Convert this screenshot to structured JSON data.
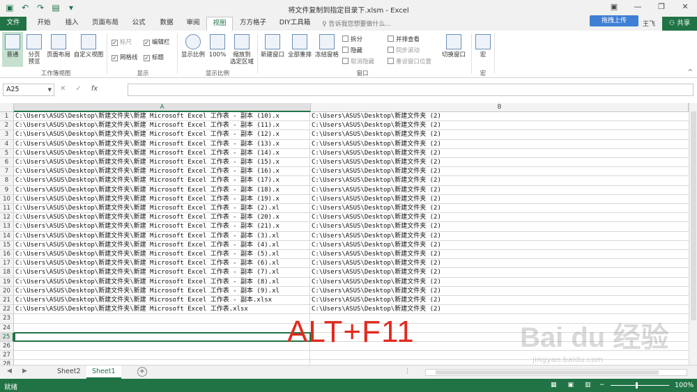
{
  "window": {
    "title": "将文件复制到指定目录下.xlsm - Excel",
    "qat_icons": [
      "save-icon",
      "undo-icon",
      "redo-icon",
      "form-icon",
      "qat-more-icon"
    ],
    "ribbon_display_icon": "▣",
    "minimize_icon": "—",
    "maximize_icon": "❐",
    "close_icon": "✕"
  },
  "tabs": [
    "文件",
    "开始",
    "插入",
    "页面布局",
    "公式",
    "数据",
    "审阅",
    "视图",
    "方方格子",
    "DIY工具箱"
  ],
  "active_tab": "视图",
  "tellme": "告诉我您想要做什么...",
  "account": {
    "upload_label": "拖拽上传",
    "user_name": "王飞",
    "share_label": "共享"
  },
  "ribbon": {
    "workbook_views": {
      "normal": "普通",
      "page_break_1": "分页",
      "page_break_2": "预览",
      "page_layout": "页面布局",
      "custom_views": "自定义视图",
      "group": "工作簿视图"
    },
    "show": {
      "ruler": "标尺",
      "formula_bar": "编辑栏",
      "gridlines": "网格线",
      "headings": "标题",
      "group": "显示"
    },
    "zoom": {
      "zoom": "显示比例",
      "hundred": "100%",
      "zoom_sel_1": "缩放到",
      "zoom_sel_2": "选定区域",
      "group": "显示比例"
    },
    "window": {
      "new_window": "新建窗口",
      "arrange_all": "全部重排",
      "freeze": "冻结窗格",
      "split": "拆分",
      "hide": "隐藏",
      "unhide": "取消隐藏",
      "side_by_side": "并排查看",
      "sync_scroll": "同步滚动",
      "reset_pos": "重设窗口位置",
      "switch": "切换窗口",
      "group": "窗口"
    },
    "macros": {
      "macros": "宏",
      "group": "宏"
    }
  },
  "formula_bar": {
    "name_box": "A25",
    "value": ""
  },
  "columns": [
    "A",
    "B"
  ],
  "rows": [
    {
      "n": "1",
      "a": "C:\\Users\\ASUS\\Desktop\\新建文件夹\\新建 Microsoft Excel 工作表 - 副本 (10).x",
      "b": "C:\\Users\\ASUS\\Desktop\\新建文件夹 (2)"
    },
    {
      "n": "2",
      "a": "C:\\Users\\ASUS\\Desktop\\新建文件夹\\新建 Microsoft Excel 工作表 - 副本 (11).x",
      "b": "C:\\Users\\ASUS\\Desktop\\新建文件夹 (2)"
    },
    {
      "n": "3",
      "a": "C:\\Users\\ASUS\\Desktop\\新建文件夹\\新建 Microsoft Excel 工作表 - 副本 (12).x",
      "b": "C:\\Users\\ASUS\\Desktop\\新建文件夹 (2)"
    },
    {
      "n": "4",
      "a": "C:\\Users\\ASUS\\Desktop\\新建文件夹\\新建 Microsoft Excel 工作表 - 副本 (13).x",
      "b": "C:\\Users\\ASUS\\Desktop\\新建文件夹 (2)"
    },
    {
      "n": "5",
      "a": "C:\\Users\\ASUS\\Desktop\\新建文件夹\\新建 Microsoft Excel 工作表 - 副本 (14).x",
      "b": "C:\\Users\\ASUS\\Desktop\\新建文件夹 (2)"
    },
    {
      "n": "6",
      "a": "C:\\Users\\ASUS\\Desktop\\新建文件夹\\新建 Microsoft Excel 工作表 - 副本 (15).x",
      "b": "C:\\Users\\ASUS\\Desktop\\新建文件夹 (2)"
    },
    {
      "n": "7",
      "a": "C:\\Users\\ASUS\\Desktop\\新建文件夹\\新建 Microsoft Excel 工作表 - 副本 (16).x",
      "b": "C:\\Users\\ASUS\\Desktop\\新建文件夹 (2)"
    },
    {
      "n": "8",
      "a": "C:\\Users\\ASUS\\Desktop\\新建文件夹\\新建 Microsoft Excel 工作表 - 副本 (17).x",
      "b": "C:\\Users\\ASUS\\Desktop\\新建文件夹 (2)"
    },
    {
      "n": "9",
      "a": "C:\\Users\\ASUS\\Desktop\\新建文件夹\\新建 Microsoft Excel 工作表 - 副本 (18).x",
      "b": "C:\\Users\\ASUS\\Desktop\\新建文件夹 (2)"
    },
    {
      "n": "10",
      "a": "C:\\Users\\ASUS\\Desktop\\新建文件夹\\新建 Microsoft Excel 工作表 - 副本 (19).x",
      "b": "C:\\Users\\ASUS\\Desktop\\新建文件夹 (2)"
    },
    {
      "n": "11",
      "a": "C:\\Users\\ASUS\\Desktop\\新建文件夹\\新建 Microsoft Excel 工作表 - 副本 (2).xl",
      "b": "C:\\Users\\ASUS\\Desktop\\新建文件夹 (2)"
    },
    {
      "n": "12",
      "a": "C:\\Users\\ASUS\\Desktop\\新建文件夹\\新建 Microsoft Excel 工作表 - 副本 (20).x",
      "b": "C:\\Users\\ASUS\\Desktop\\新建文件夹 (2)"
    },
    {
      "n": "13",
      "a": "C:\\Users\\ASUS\\Desktop\\新建文件夹\\新建 Microsoft Excel 工作表 - 副本 (21).x",
      "b": "C:\\Users\\ASUS\\Desktop\\新建文件夹 (2)"
    },
    {
      "n": "14",
      "a": "C:\\Users\\ASUS\\Desktop\\新建文件夹\\新建 Microsoft Excel 工作表 - 副本 (3).xl",
      "b": "C:\\Users\\ASUS\\Desktop\\新建文件夹 (2)"
    },
    {
      "n": "15",
      "a": "C:\\Users\\ASUS\\Desktop\\新建文件夹\\新建 Microsoft Excel 工作表 - 副本 (4).xl",
      "b": "C:\\Users\\ASUS\\Desktop\\新建文件夹 (2)"
    },
    {
      "n": "16",
      "a": "C:\\Users\\ASUS\\Desktop\\新建文件夹\\新建 Microsoft Excel 工作表 - 副本 (5).xl",
      "b": "C:\\Users\\ASUS\\Desktop\\新建文件夹 (2)"
    },
    {
      "n": "17",
      "a": "C:\\Users\\ASUS\\Desktop\\新建文件夹\\新建 Microsoft Excel 工作表 - 副本 (6).xl",
      "b": "C:\\Users\\ASUS\\Desktop\\新建文件夹 (2)"
    },
    {
      "n": "18",
      "a": "C:\\Users\\ASUS\\Desktop\\新建文件夹\\新建 Microsoft Excel 工作表 - 副本 (7).xl",
      "b": "C:\\Users\\ASUS\\Desktop\\新建文件夹 (2)"
    },
    {
      "n": "19",
      "a": "C:\\Users\\ASUS\\Desktop\\新建文件夹\\新建 Microsoft Excel 工作表 - 副本 (8).xl",
      "b": "C:\\Users\\ASUS\\Desktop\\新建文件夹 (2)"
    },
    {
      "n": "20",
      "a": "C:\\Users\\ASUS\\Desktop\\新建文件夹\\新建 Microsoft Excel 工作表 - 副本 (9).xl",
      "b": "C:\\Users\\ASUS\\Desktop\\新建文件夹 (2)"
    },
    {
      "n": "21",
      "a": "C:\\Users\\ASUS\\Desktop\\新建文件夹\\新建 Microsoft Excel 工作表 - 副本.xlsx",
      "b": "C:\\Users\\ASUS\\Desktop\\新建文件夹 (2)"
    },
    {
      "n": "22",
      "a": "C:\\Users\\ASUS\\Desktop\\新建文件夹\\新建 Microsoft Excel 工作表.xlsx",
      "b": "C:\\Users\\ASUS\\Desktop\\新建文件夹 (2)"
    },
    {
      "n": "23",
      "a": "",
      "b": ""
    },
    {
      "n": "24",
      "a": "",
      "b": ""
    },
    {
      "n": "25",
      "a": "",
      "b": ""
    },
    {
      "n": "26",
      "a": "",
      "b": ""
    },
    {
      "n": "27",
      "a": "",
      "b": ""
    },
    {
      "n": "28",
      "a": "",
      "b": ""
    }
  ],
  "overlay_text": "ALT+F11",
  "watermark": {
    "main": "Bai du 经验",
    "sub": "jingyan.baidu.com"
  },
  "sheets": [
    "Sheet2",
    "Sheet1"
  ],
  "active_sheet": "Sheet1",
  "status": {
    "ready": "就绪",
    "zoom": "100%"
  },
  "colors": {
    "excel_green": "#217346",
    "overlay_red": "#e02b20",
    "upload_blue": "#3f7fd4"
  }
}
